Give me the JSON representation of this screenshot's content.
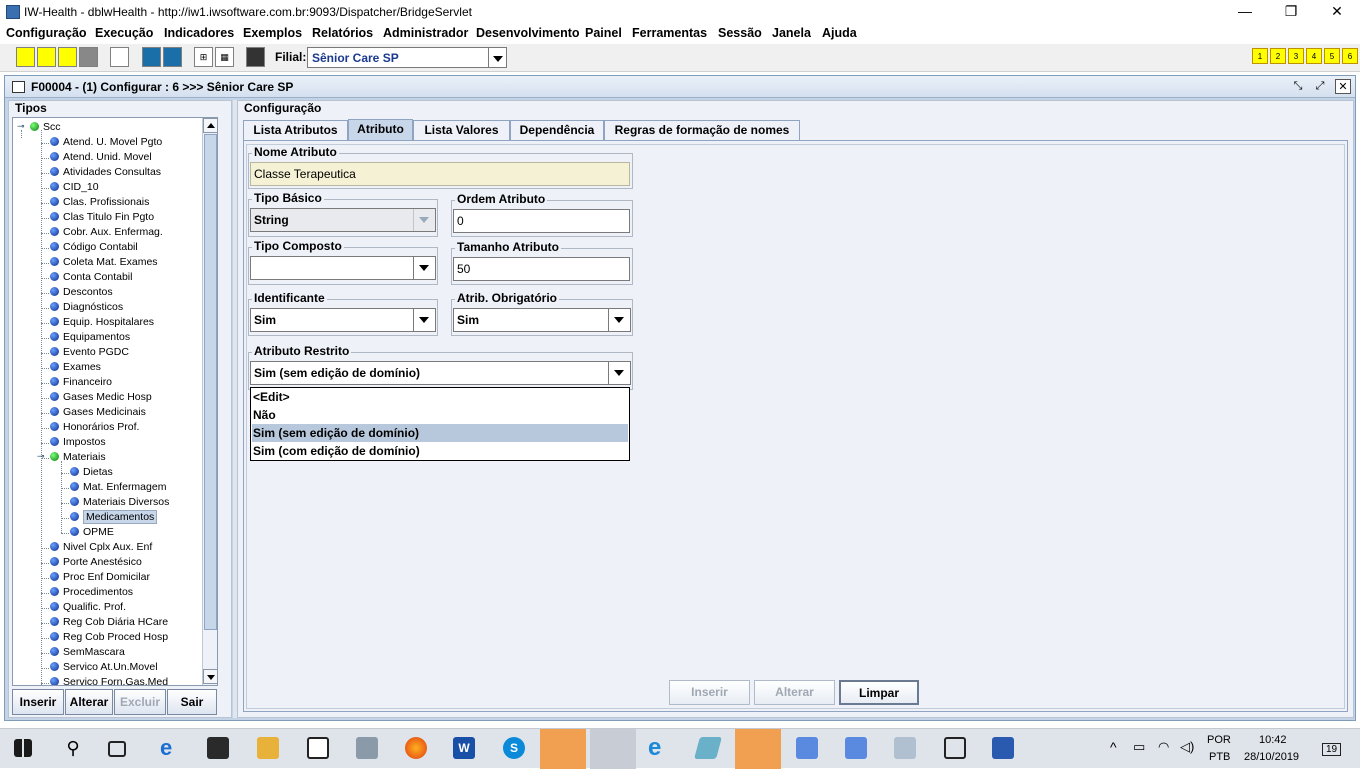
{
  "window": {
    "title": "IW-Health - dblwHealth - http://iw1.iwsoftware.com.br:9093/Dispatcher/BridgeServlet",
    "minimize": "—",
    "maximize": "❐",
    "close": "✕"
  },
  "menu": [
    "Configuração",
    "Execução",
    "Indicadores",
    "Exemplos",
    "Relatórios",
    "Administrador",
    "Desenvolvimento",
    "Painel",
    "Ferramentas",
    "Sessão",
    "Janela",
    "Ajuda"
  ],
  "toolbar": {
    "filial_label": "Filial:",
    "filial_value": "Sênior Care SP",
    "numbered": [
      "1",
      "2",
      "3",
      "4",
      "5",
      "6"
    ]
  },
  "frame": {
    "title": "F00004 - (1) Configurar : 6 >>> Sênior Care SP"
  },
  "left": {
    "group_label": "Tipos",
    "tree_root": "Scc",
    "tree_items": [
      "Atend. U. Movel Pgto",
      "Atend. Unid. Movel",
      "Atividades Consultas",
      "CID_10",
      "Clas. Profissionais",
      "Clas Titulo Fin Pgto",
      "Cobr. Aux. Enfermag.",
      "Código Contabil",
      "Coleta Mat. Exames",
      "Conta Contabil",
      "Descontos",
      "Diagnósticos",
      "Equip. Hospitalares",
      "Equipamentos",
      "Evento PGDC",
      "Exames",
      "Financeiro",
      "Gases Medic Hosp",
      "Gases Medicinais",
      "Honorários Prof.",
      "Impostos",
      "Materiais"
    ],
    "tree_children": [
      "Dietas",
      "Mat. Enfermagem",
      "Materiais Diversos",
      "Medicamentos",
      "OPME"
    ],
    "tree_items_after": [
      "Nivel Cplx Aux. Enf",
      "Porte Anestésico",
      "Proc Enf Domicilar",
      "Procedimentos",
      "Qualific. Prof.",
      "Reg Cob Diária HCare",
      "Reg Cob Proced Hosp",
      "SemMascara",
      "Servico At.Un.Movel",
      "Servico Forn.Gas.Med"
    ],
    "buttons": {
      "insert": "Inserir",
      "alter": "Alterar",
      "delete": "Excluir",
      "exit": "Sair"
    }
  },
  "right": {
    "group_label": "Configuração",
    "tabs": [
      "Lista Atributos",
      "Atributo",
      "Lista Valores",
      "Dependência",
      "Regras de formação de nomes"
    ],
    "fields": {
      "nome_atributo": {
        "label": "Nome Atributo",
        "value": "Classe Terapeutica"
      },
      "tipo_basico": {
        "label": "Tipo Básico",
        "value": "String"
      },
      "ordem_atributo": {
        "label": "Ordem Atributo",
        "value": "0"
      },
      "tipo_composto": {
        "label": "Tipo Composto",
        "value": ""
      },
      "tamanho_atributo": {
        "label": "Tamanho Atributo",
        "value": "50"
      },
      "identificante": {
        "label": "Identificante",
        "value": "Sim"
      },
      "atrib_obrigatorio": {
        "label": "Atrib. Obrigatório",
        "value": "Sim"
      },
      "atributo_restrito": {
        "label": "Atributo Restrito",
        "value": "Sim (sem edição de domínio)"
      }
    },
    "dropdown_options": [
      "<Edit>",
      "Não",
      "Sim (sem edição de domínio)",
      "Sim (com edição de domínio)"
    ],
    "buttons": {
      "insert": "Inserir",
      "alter": "Alterar",
      "clear": "Limpar"
    }
  },
  "taskbar": {
    "lang1": "POR",
    "lang2": "PTB",
    "time": "10:42",
    "date": "28/10/2019",
    "notifications": "19"
  }
}
